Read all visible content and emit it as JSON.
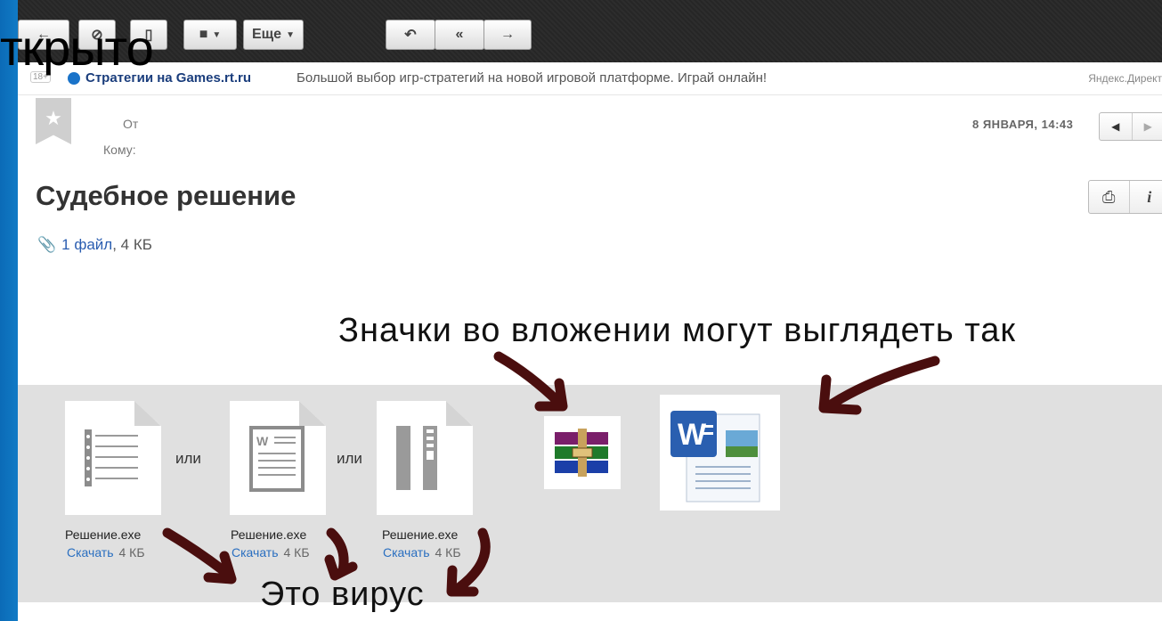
{
  "slide": {
    "title_fragment": "ткрыто",
    "caption": "Значки во вложении могут выглядеть так",
    "virus_note": "Это вирус"
  },
  "toolbar": {
    "back_icon": "arrow-left-icon",
    "spam_icon": "block-icon",
    "delete_icon": "trash-icon",
    "folder_icon": "folder-icon",
    "more_label": "Еще",
    "reply_icon": "reply-icon",
    "reply_all_icon": "reply-all-icon",
    "forward_icon": "forward-icon"
  },
  "ad": {
    "age": "18+",
    "link": "Стратегии на Games.rt.ru",
    "text": "Большой выбор игр-стратегий на новой игровой платформе. Играй онлайн!",
    "source": "Яндекс.Директ"
  },
  "message": {
    "from_label": "От",
    "to_label": "Кому:",
    "date": "8 ЯНВАРЯ, 14:43",
    "subject": "Судебное решение",
    "attachments_link": "1 файл",
    "attachments_size": ", 4 КБ"
  },
  "files": [
    {
      "name": "Решение.exe",
      "download": "Скачать",
      "size": "4 КБ",
      "icon": "text-document-icon"
    },
    {
      "name": "Решение.exe",
      "download": "Скачать",
      "size": "4 КБ",
      "icon": "word-document-icon"
    },
    {
      "name": "Решение.exe",
      "download": "Скачать",
      "size": "4 КБ",
      "icon": "zip-archive-icon"
    }
  ],
  "separators": {
    "or_1": "или",
    "or_2": "или"
  },
  "colors": {
    "link": "#2a6fc0",
    "arrow": "#4a0e0e",
    "slide_blue": "#1f8fd6"
  }
}
